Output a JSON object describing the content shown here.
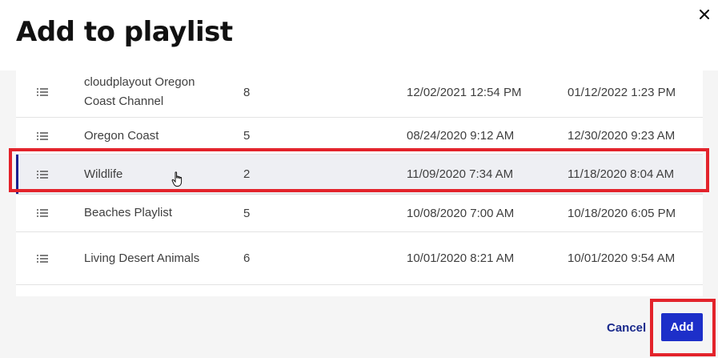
{
  "dialog": {
    "title": "Add to playlist",
    "close_icon": "close-icon"
  },
  "playlists": [
    {
      "name": "cloudplayout Oregon Coast Channel",
      "count": "8",
      "created": "12/02/2021 12:54 PM",
      "modified": "01/12/2022 1:23 PM",
      "selected": false
    },
    {
      "name": "Oregon Coast",
      "count": "5",
      "created": "08/24/2020 9:12 AM",
      "modified": "12/30/2020 9:23 AM",
      "selected": false
    },
    {
      "name": "Wildlife",
      "count": "2",
      "created": "11/09/2020 7:34 AM",
      "modified": "11/18/2020 8:04 AM",
      "selected": true
    },
    {
      "name": "Beaches Playlist",
      "count": "5",
      "created": "10/08/2020 7:00 AM",
      "modified": "10/18/2020 6:05 PM",
      "selected": false
    },
    {
      "name": "Living Desert Animals",
      "count": "6",
      "created": "10/01/2020 8:21 AM",
      "modified": "10/01/2020 9:54 AM",
      "selected": false
    }
  ],
  "footer": {
    "cancel_label": "Cancel",
    "add_label": "Add"
  },
  "colors": {
    "accent": "#1d2fc9",
    "link": "#1a2a8c",
    "selection_bar": "#1a1f8f",
    "annotation_red": "#e3232b"
  }
}
